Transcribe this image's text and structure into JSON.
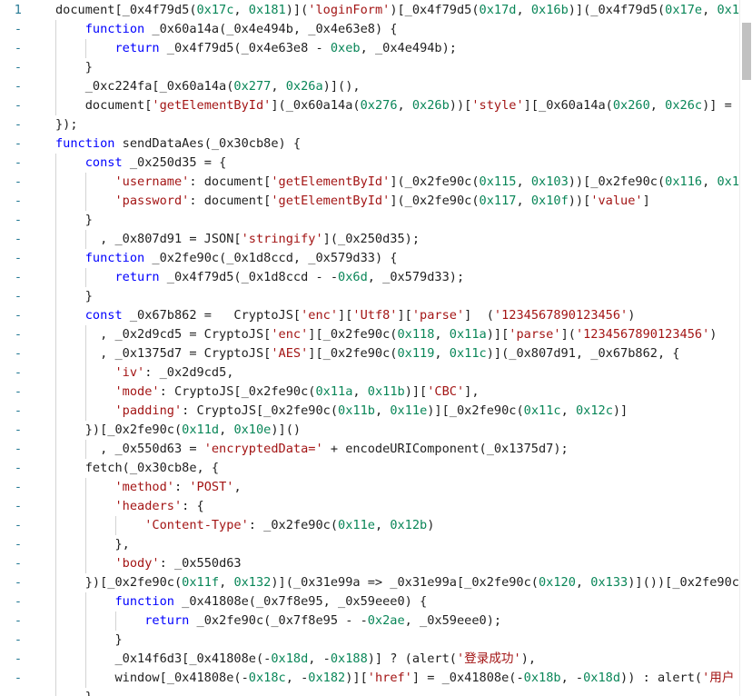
{
  "editor": {
    "colors": {
      "string": "#a31515",
      "number": "#098658",
      "keyword": "#0000ff",
      "plain": "#1f1f1f",
      "gutter": "#237893"
    },
    "lines": [
      {
        "g": "1",
        "tokens": [
          [
            "document[_0x4f79d5(",
            "p"
          ],
          [
            "0x17c",
            "n"
          ],
          [
            ", ",
            "p"
          ],
          [
            "0x181",
            "n"
          ],
          [
            ")](",
            "p"
          ],
          [
            "'loginForm'",
            "s"
          ],
          [
            ")[_0x4f79d5(",
            "p"
          ],
          [
            "0x17d",
            "n"
          ],
          [
            ", ",
            "p"
          ],
          [
            "0x16b",
            "n"
          ],
          [
            ")](_0x4f79d5(",
            "p"
          ],
          [
            "0x17e",
            "n"
          ],
          [
            ", ",
            "p"
          ],
          [
            "0x1",
            "n"
          ]
        ]
      },
      {
        "g": "-",
        "tokens": [
          [
            "    ",
            "p"
          ],
          [
            "function",
            "k"
          ],
          [
            " _0x60a14a(_0x4e494b, _0x4e63e8) {",
            "p"
          ]
        ]
      },
      {
        "g": "-",
        "tokens": [
          [
            "        ",
            "p"
          ],
          [
            "return",
            "k"
          ],
          [
            " _0x4f79d5(_0x4e63e8 - ",
            "p"
          ],
          [
            "0xeb",
            "n"
          ],
          [
            ", _0x4e494b);",
            "p"
          ]
        ]
      },
      {
        "g": "-",
        "tokens": [
          [
            "    }",
            "p"
          ]
        ]
      },
      {
        "g": "-",
        "tokens": [
          [
            "    _0xc224fa[_0x60a14a(",
            "p"
          ],
          [
            "0x277",
            "n"
          ],
          [
            ", ",
            "p"
          ],
          [
            "0x26a",
            "n"
          ],
          [
            ")](),",
            "p"
          ]
        ]
      },
      {
        "g": "-",
        "tokens": [
          [
            "    document[",
            "p"
          ],
          [
            "'getElementById'",
            "s"
          ],
          [
            "](_0x60a14a(",
            "p"
          ],
          [
            "0x276",
            "n"
          ],
          [
            ", ",
            "p"
          ],
          [
            "0x26b",
            "n"
          ],
          [
            "))[",
            "p"
          ],
          [
            "'style'",
            "s"
          ],
          [
            "][_0x60a14a(",
            "p"
          ],
          [
            "0x260",
            "n"
          ],
          [
            ", ",
            "p"
          ],
          [
            "0x26c",
            "n"
          ],
          [
            ")] = ",
            "p"
          ]
        ]
      },
      {
        "g": "-",
        "tokens": [
          [
            "});",
            "p"
          ]
        ]
      },
      {
        "g": "-",
        "tokens": [
          [
            "function",
            "k"
          ],
          [
            " sendDataAes(_0x30cb8e) {",
            "p"
          ]
        ]
      },
      {
        "g": "-",
        "tokens": [
          [
            "    ",
            "p"
          ],
          [
            "const",
            "k"
          ],
          [
            " _0x250d35 = {",
            "p"
          ]
        ]
      },
      {
        "g": "-",
        "tokens": [
          [
            "        ",
            "p"
          ],
          [
            "'username'",
            "s"
          ],
          [
            ": document[",
            "p"
          ],
          [
            "'getElementById'",
            "s"
          ],
          [
            "](_0x2fe90c(",
            "p"
          ],
          [
            "0x115",
            "n"
          ],
          [
            ", ",
            "p"
          ],
          [
            "0x103",
            "n"
          ],
          [
            "))[_0x2fe90c(",
            "p"
          ],
          [
            "0x116",
            "n"
          ],
          [
            ", ",
            "p"
          ],
          [
            "0x1",
            "n"
          ]
        ]
      },
      {
        "g": "-",
        "tokens": [
          [
            "        ",
            "p"
          ],
          [
            "'password'",
            "s"
          ],
          [
            ": document[",
            "p"
          ],
          [
            "'getElementById'",
            "s"
          ],
          [
            "](_0x2fe90c(",
            "p"
          ],
          [
            "0x117",
            "n"
          ],
          [
            ", ",
            "p"
          ],
          [
            "0x10f",
            "n"
          ],
          [
            "))[",
            "p"
          ],
          [
            "'value'",
            "s"
          ],
          [
            "]",
            "p"
          ]
        ]
      },
      {
        "g": "-",
        "tokens": [
          [
            "    }",
            "p"
          ]
        ]
      },
      {
        "g": "-",
        "tokens": [
          [
            "      , _0x807d91 = JSON[",
            "p"
          ],
          [
            "'stringify'",
            "s"
          ],
          [
            "](_0x250d35);",
            "p"
          ]
        ]
      },
      {
        "g": "-",
        "tokens": [
          [
            "    ",
            "p"
          ],
          [
            "function",
            "k"
          ],
          [
            " _0x2fe90c(_0x1d8ccd, _0x579d33) {",
            "p"
          ]
        ]
      },
      {
        "g": "-",
        "tokens": [
          [
            "        ",
            "p"
          ],
          [
            "return",
            "k"
          ],
          [
            " _0x4f79d5(_0x1d8ccd - -",
            "p"
          ],
          [
            "0x6d",
            "n"
          ],
          [
            ", _0x579d33);",
            "p"
          ]
        ]
      },
      {
        "g": "-",
        "tokens": [
          [
            "    }",
            "p"
          ]
        ]
      },
      {
        "g": "-",
        "tokens": [
          [
            "    ",
            "p"
          ],
          [
            "const",
            "k"
          ],
          [
            " _0x67b862 =   CryptoJS[",
            "p"
          ],
          [
            "'enc'",
            "s"
          ],
          [
            "][",
            "p"
          ],
          [
            "'Utf8'",
            "s"
          ],
          [
            "][",
            "p"
          ],
          [
            "'parse'",
            "s"
          ],
          [
            "]  (",
            "p"
          ],
          [
            "'1234567890123456'",
            "s"
          ],
          [
            ")",
            "p"
          ]
        ]
      },
      {
        "g": "-",
        "tokens": [
          [
            "      , _0x2d9cd5 = CryptoJS[",
            "p"
          ],
          [
            "'enc'",
            "s"
          ],
          [
            "][_0x2fe90c(",
            "p"
          ],
          [
            "0x118",
            "n"
          ],
          [
            ", ",
            "p"
          ],
          [
            "0x11a",
            "n"
          ],
          [
            ")][",
            "p"
          ],
          [
            "'parse'",
            "s"
          ],
          [
            "](",
            "p"
          ],
          [
            "'1234567890123456'",
            "s"
          ],
          [
            ")",
            "p"
          ]
        ]
      },
      {
        "g": "-",
        "tokens": [
          [
            "      , _0x1375d7 = CryptoJS[",
            "p"
          ],
          [
            "'AES'",
            "s"
          ],
          [
            "][_0x2fe90c(",
            "p"
          ],
          [
            "0x119",
            "n"
          ],
          [
            ", ",
            "p"
          ],
          [
            "0x11c",
            "n"
          ],
          [
            ")](_0x807d91, _0x67b862, {",
            "p"
          ]
        ]
      },
      {
        "g": "-",
        "tokens": [
          [
            "        ",
            "p"
          ],
          [
            "'iv'",
            "s"
          ],
          [
            ": _0x2d9cd5,",
            "p"
          ]
        ]
      },
      {
        "g": "-",
        "tokens": [
          [
            "        ",
            "p"
          ],
          [
            "'mode'",
            "s"
          ],
          [
            ": CryptoJS[_0x2fe90c(",
            "p"
          ],
          [
            "0x11a",
            "n"
          ],
          [
            ", ",
            "p"
          ],
          [
            "0x11b",
            "n"
          ],
          [
            ")][",
            "p"
          ],
          [
            "'CBC'",
            "s"
          ],
          [
            "],",
            "p"
          ]
        ]
      },
      {
        "g": "-",
        "tokens": [
          [
            "        ",
            "p"
          ],
          [
            "'padding'",
            "s"
          ],
          [
            ": CryptoJS[_0x2fe90c(",
            "p"
          ],
          [
            "0x11b",
            "n"
          ],
          [
            ", ",
            "p"
          ],
          [
            "0x11e",
            "n"
          ],
          [
            ")][_0x2fe90c(",
            "p"
          ],
          [
            "0x11c",
            "n"
          ],
          [
            ", ",
            "p"
          ],
          [
            "0x12c",
            "n"
          ],
          [
            ")]",
            "p"
          ]
        ]
      },
      {
        "g": "-",
        "tokens": [
          [
            "    })[_0x2fe90c(",
            "p"
          ],
          [
            "0x11d",
            "n"
          ],
          [
            ", ",
            "p"
          ],
          [
            "0x10e",
            "n"
          ],
          [
            ")]()",
            "p"
          ]
        ]
      },
      {
        "g": "-",
        "tokens": [
          [
            "      , _0x550d63 = ",
            "p"
          ],
          [
            "'encryptedData='",
            "s"
          ],
          [
            " + encodeURIComponent(_0x1375d7);",
            "p"
          ]
        ]
      },
      {
        "g": "-",
        "tokens": [
          [
            "    fetch(_0x30cb8e, {",
            "p"
          ]
        ]
      },
      {
        "g": "-",
        "tokens": [
          [
            "        ",
            "p"
          ],
          [
            "'method'",
            "s"
          ],
          [
            ": ",
            "p"
          ],
          [
            "'POST'",
            "s"
          ],
          [
            ",",
            "p"
          ]
        ]
      },
      {
        "g": "-",
        "tokens": [
          [
            "        ",
            "p"
          ],
          [
            "'headers'",
            "s"
          ],
          [
            ": {",
            "p"
          ]
        ]
      },
      {
        "g": "-",
        "tokens": [
          [
            "            ",
            "p"
          ],
          [
            "'Content-Type'",
            "s"
          ],
          [
            ": _0x2fe90c(",
            "p"
          ],
          [
            "0x11e",
            "n"
          ],
          [
            ", ",
            "p"
          ],
          [
            "0x12b",
            "n"
          ],
          [
            ")",
            "p"
          ]
        ]
      },
      {
        "g": "-",
        "tokens": [
          [
            "        },",
            "p"
          ]
        ]
      },
      {
        "g": "-",
        "tokens": [
          [
            "        ",
            "p"
          ],
          [
            "'body'",
            "s"
          ],
          [
            ": _0x550d63",
            "p"
          ]
        ]
      },
      {
        "g": "-",
        "tokens": [
          [
            "    })[_0x2fe90c(",
            "p"
          ],
          [
            "0x11f",
            "n"
          ],
          [
            ", ",
            "p"
          ],
          [
            "0x132",
            "n"
          ],
          [
            ")](_0x31e99a => _0x31e99a[_0x2fe90c(",
            "p"
          ],
          [
            "0x120",
            "n"
          ],
          [
            ", ",
            "p"
          ],
          [
            "0x133",
            "n"
          ],
          [
            ")]())[_0x2fe90c",
            "p"
          ]
        ]
      },
      {
        "g": "-",
        "tokens": [
          [
            "        ",
            "p"
          ],
          [
            "function",
            "k"
          ],
          [
            " _0x41808e(_0x7f8e95, _0x59eee0) {",
            "p"
          ]
        ]
      },
      {
        "g": "-",
        "tokens": [
          [
            "            ",
            "p"
          ],
          [
            "return",
            "k"
          ],
          [
            " _0x2fe90c(_0x7f8e95 - -",
            "p"
          ],
          [
            "0x2ae",
            "n"
          ],
          [
            ", _0x59eee0);",
            "p"
          ]
        ]
      },
      {
        "g": "-",
        "tokens": [
          [
            "        }",
            "p"
          ]
        ]
      },
      {
        "g": "-",
        "tokens": [
          [
            "        _0x14f6d3[_0x41808e(-",
            "p"
          ],
          [
            "0x18d",
            "n"
          ],
          [
            ", -",
            "p"
          ],
          [
            "0x188",
            "n"
          ],
          [
            ")] ? (alert(",
            "p"
          ],
          [
            "'登录成功'",
            "s"
          ],
          [
            "),",
            "p"
          ]
        ]
      },
      {
        "g": "-",
        "tokens": [
          [
            "        window[_0x41808e(-",
            "p"
          ],
          [
            "0x18c",
            "n"
          ],
          [
            ", -",
            "p"
          ],
          [
            "0x182",
            "n"
          ],
          [
            ")][",
            "p"
          ],
          [
            "'href'",
            "s"
          ],
          [
            "] = _0x41808e(-",
            "p"
          ],
          [
            "0x18b",
            "n"
          ],
          [
            ", -",
            "p"
          ],
          [
            "0x18d",
            "n"
          ],
          [
            ")) : alert(",
            "p"
          ],
          [
            "'用户",
            "s"
          ]
        ]
      },
      {
        "g": "-",
        "tokens": [
          [
            "    }",
            "p"
          ]
        ]
      }
    ]
  },
  "scrollbar": {
    "label": "vertical-scrollbar"
  }
}
